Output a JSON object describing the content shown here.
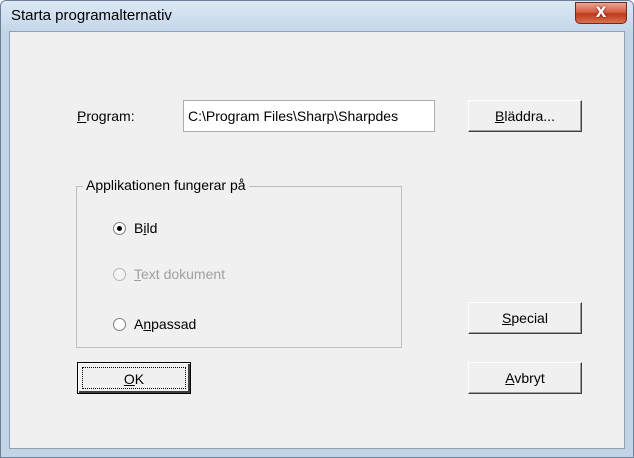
{
  "window": {
    "title": "Starta programalternativ",
    "close_glyph": "X"
  },
  "program": {
    "label_prefix": "",
    "label_access": "P",
    "label_rest": "rogram:",
    "value": "C:\\Program Files\\Sharp\\Sharpdes"
  },
  "browse_button": {
    "access": "B",
    "rest": "läddra..."
  },
  "group": {
    "legend": "Applikationen fungerar på",
    "options": [
      {
        "pre": "B",
        "access": "i",
        "rest": "ld",
        "selected": true,
        "enabled": true
      },
      {
        "pre": "",
        "access": "T",
        "rest": "ext dokument",
        "selected": false,
        "enabled": false
      },
      {
        "pre": "A",
        "access": "n",
        "rest": "passad",
        "selected": false,
        "enabled": true
      }
    ]
  },
  "special_button": {
    "access": "S",
    "rest": "pecial"
  },
  "ok_button": {
    "access": "O",
    "rest": "K"
  },
  "cancel_button": {
    "access": "A",
    "rest": "vbryt"
  },
  "icons": {
    "close": "close-icon",
    "radio": "radio-button"
  },
  "colors": {
    "title_bar": "#c5d6ea",
    "close_button": "#c0381e",
    "dialog_face": "#f0f0f0",
    "disabled_text": "#a0a0a0"
  }
}
